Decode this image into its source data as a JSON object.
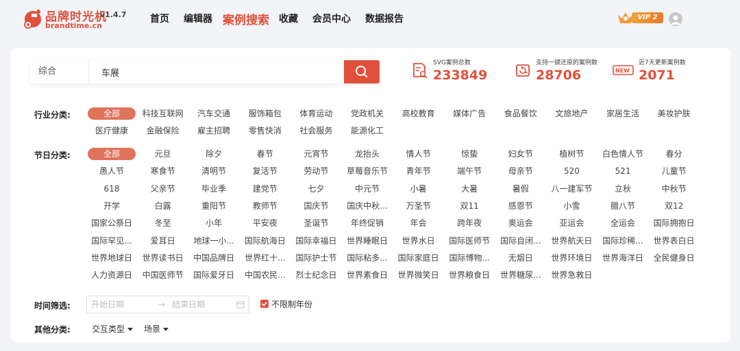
{
  "brand": {
    "name_cn": "品牌时光机",
    "name_en": "brandtime.cn",
    "version": "v1.4.7"
  },
  "nav": [
    "首页",
    "编辑器",
    "案例搜索",
    "收藏",
    "会员中心",
    "数据报告"
  ],
  "nav_active": 2,
  "vip": {
    "label": "VIP 2"
  },
  "search": {
    "type": "综合",
    "value": "车展"
  },
  "stats": [
    {
      "label": "SVG案例总数",
      "value": "233849",
      "icon": "document-search-icon"
    },
    {
      "label": "支持一键还原的案例数",
      "value": "28706",
      "icon": "restore-icon"
    },
    {
      "label": "近7天更新案例数",
      "value": "2071",
      "icon": "new-badge-icon",
      "badge": "NEW"
    }
  ],
  "industry": {
    "label": "行业分类:",
    "tags": [
      "全部",
      "科技互联网",
      "汽车交通",
      "服饰箱包",
      "体育运动",
      "党政机关",
      "高校教育",
      "媒体广告",
      "食品餐饮",
      "文旅地产",
      "家居生活",
      "美妆护肤",
      "医疗健康",
      "金融保险",
      "雇主招聘",
      "零售快消",
      "社会服务",
      "能源化工"
    ]
  },
  "festival": {
    "label": "节日分类:",
    "tags": [
      "全部",
      "元旦",
      "除夕",
      "春节",
      "元宵节",
      "龙抬头",
      "情人节",
      "惊蛰",
      "妇女节",
      "植树节",
      "白色情人节",
      "春分",
      "愚人节",
      "寒食节",
      "清明节",
      "复活节",
      "劳动节",
      "草莓音乐节",
      "青年节",
      "端午节",
      "母亲节",
      "520",
      "521",
      "儿童节",
      "618",
      "父亲节",
      "毕业季",
      "建党节",
      "七夕",
      "中元节",
      "小暑",
      "大暑",
      "暑假",
      "八一建军节",
      "立秋",
      "中秋节",
      "开学",
      "白露",
      "重阳节",
      "教师节",
      "国庆节",
      "国庆中秋...",
      "万圣节",
      "双11",
      "感恩节",
      "小雪",
      "腊八节",
      "双12",
      "国家公祭日",
      "冬至",
      "小年",
      "平安夜",
      "圣诞节",
      "年终促销",
      "年会",
      "跨年夜",
      "奥运会",
      "亚运会",
      "全运会",
      "国际拥抱日",
      "国际罕见...",
      "爱耳日",
      "地球一小...",
      "国际航海日",
      "国际幸福日",
      "世界睡眠日",
      "世界水日",
      "国际医师节",
      "国际自闭...",
      "世界航天日",
      "国际珍稀...",
      "世界表白日",
      "世界地球日",
      "世界读书日",
      "中国品牌日",
      "世界红十...",
      "国际护士节",
      "国际粘多...",
      "国际家庭日",
      "国际博物...",
      "无烟日",
      "世界环境日",
      "世界海洋日",
      "全民健身日",
      "人力资源日",
      "中国医师节",
      "国际爱牙日",
      "中国农民...",
      "烈士纪念日",
      "世界素食日",
      "世界微笑日",
      "世界粮食日",
      "世界糖尿...",
      "世界急救日"
    ]
  },
  "time": {
    "label": "时间筛选:",
    "start_placeholder": "开始日期",
    "arrow": "→",
    "end_placeholder": "结束日期",
    "unlimited": "不限制年份"
  },
  "other": {
    "label": "其他分类:",
    "interaction": "交互类型",
    "scene": "场景"
  }
}
